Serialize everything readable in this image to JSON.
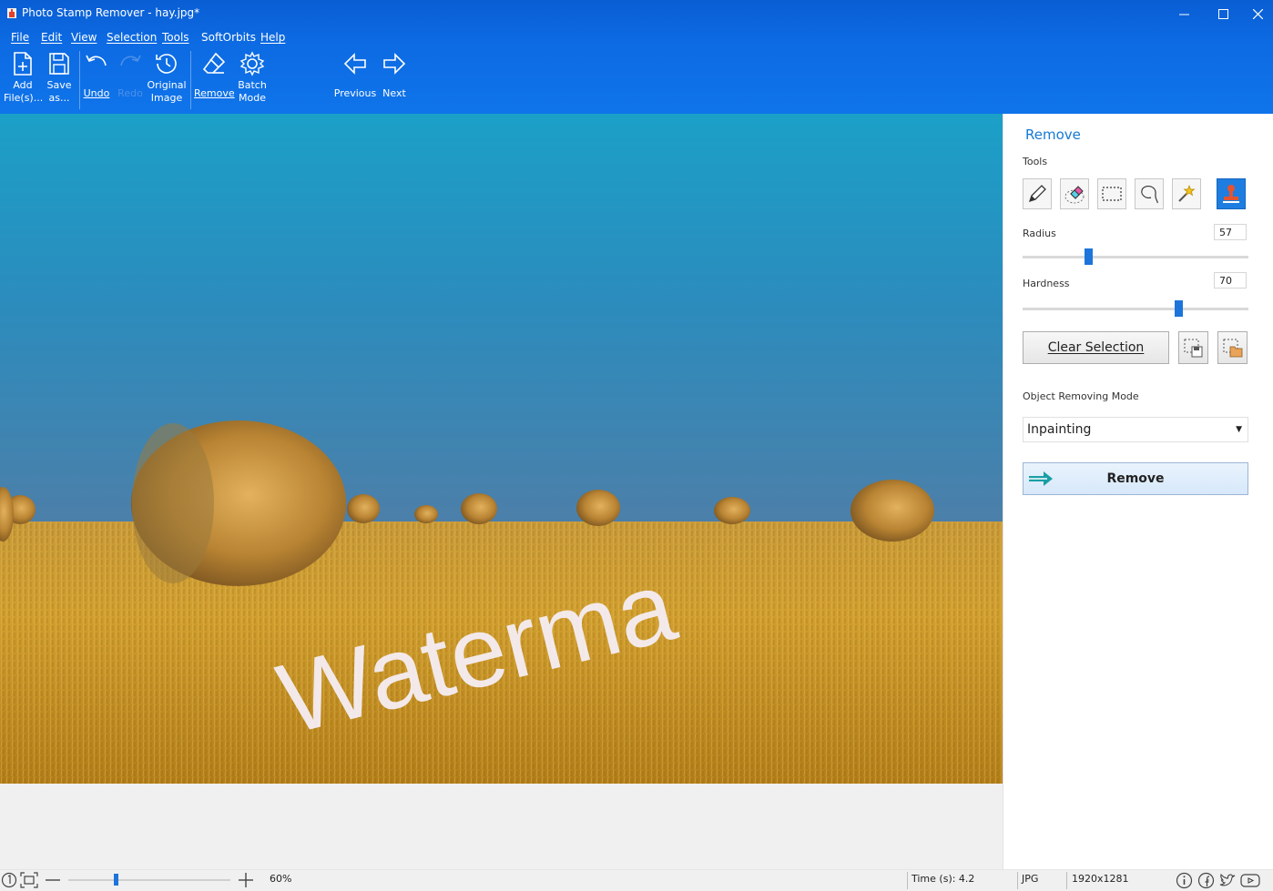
{
  "window": {
    "title": "Photo Stamp Remover - hay.jpg*",
    "minimize": "—",
    "maximize": "☐",
    "close": "✕"
  },
  "menu": [
    "File",
    "Edit",
    "View",
    "Selection",
    "Tools",
    "SoftOrbits",
    "Help"
  ],
  "toolbar": {
    "add_files": "Add\nFile(s)...",
    "save_as": "Save\nas...",
    "undo": "Undo",
    "redo": "Redo",
    "original_image": "Original\nImage",
    "remove": "Remove",
    "batch_mode": "Batch\nMode",
    "previous": "Previous",
    "next": "Next"
  },
  "canvas": {
    "watermark_text": "Waterma"
  },
  "panel": {
    "title": "Remove",
    "tools_label": "Tools",
    "tools": [
      "pencil-icon",
      "eraser-icon",
      "rect-select-icon",
      "lasso-icon",
      "magic-wand-icon",
      "stamp-icon"
    ],
    "active_tool": "stamp-icon",
    "radius_label": "Radius",
    "radius_value": "57",
    "radius_fraction": 0.29,
    "hardness_label": "Hardness",
    "hardness_value": "70",
    "hardness_fraction": 0.69,
    "clear_selection": "Clear Selection",
    "mode_label": "Object Removing Mode",
    "mode_value": "Inpainting",
    "remove_button": "Remove"
  },
  "status": {
    "zoom_fraction": 0.29,
    "zoom": "60%",
    "time": "Time (s): 4.2",
    "format": "JPG",
    "dimensions": "1920x1281"
  },
  "colors": {
    "title_blue": "#0a5ed4",
    "accent": "#1e7de0",
    "panel_title": "#1679d4"
  }
}
